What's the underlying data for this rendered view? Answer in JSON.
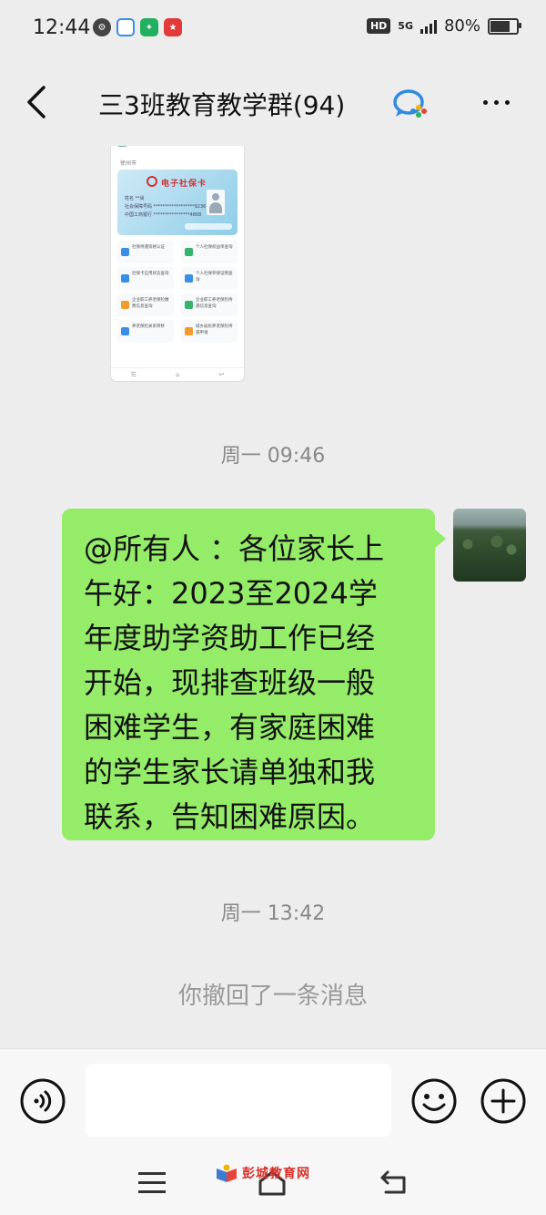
{
  "status_bar": {
    "time": "12:44",
    "network": "5G",
    "battery": "80%",
    "hd": "HD",
    "battery_level": 0.8
  },
  "header": {
    "title": "三3班教育教学群(94)"
  },
  "shared_screenshot": {
    "location": "徐州市",
    "card_title": "电子社保卡",
    "card_lines": [
      "姓名 **尚",
      "社会保障号码 ******************9236",
      "中国工商银行 ****************4868"
    ],
    "services": [
      "社保待遇资格认证",
      "个人社保权益单查询",
      "社保卡应用状态查询",
      "个人社保参保证明查询",
      "企业职工养老保险缴费信息查询",
      "企业职工养老保险待遇信息查询",
      "养老保险关系转移",
      "城乡居民养老保险待遇申请"
    ]
  },
  "messages": {
    "time_1": "周一 09:46",
    "bubble_lines": [
      "@所有人 ：各位家长上",
      "午好：2023至2024学",
      "年度助学资助工作已经",
      "开始，现排查班级一般",
      "困难学生，有家庭困难",
      "的学生家长请单独和我",
      "联系，告知困难原因。"
    ],
    "time_2": "周一 13:42",
    "recall_notice": "你撤回了一条消息"
  },
  "input_bar": {
    "placeholder": ""
  },
  "watermark": {
    "text": "彭城教育网"
  },
  "colors": {
    "bubble": "#95ec69",
    "background": "#ededed"
  }
}
